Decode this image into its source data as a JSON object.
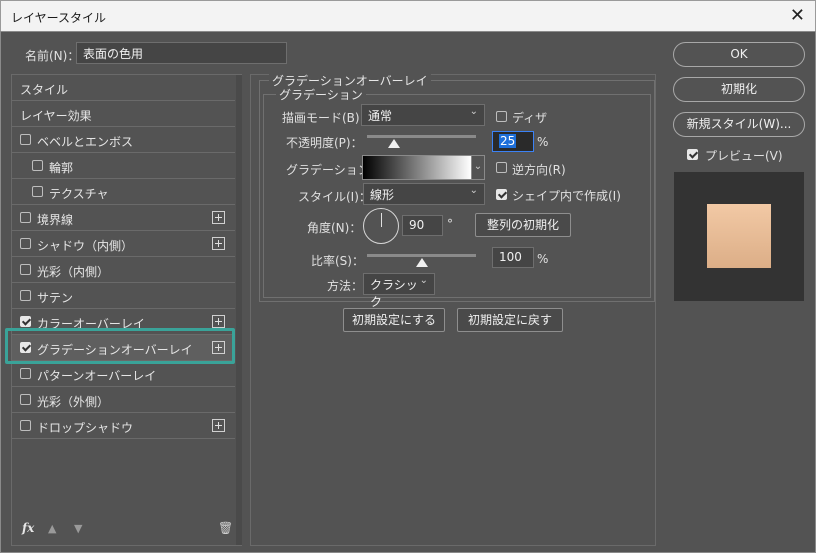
{
  "window": {
    "title": "レイヤースタイル"
  },
  "name": {
    "label": "名前(N)：",
    "value": "表面の色用"
  },
  "style_list": [
    {
      "label": "スタイル",
      "indent": 0,
      "checkbox": false,
      "checked": false,
      "plus": false,
      "selected": false
    },
    {
      "label": "レイヤー効果",
      "indent": 0,
      "checkbox": false,
      "checked": false,
      "plus": false,
      "selected": false
    },
    {
      "label": "ベベルとエンボス",
      "indent": 0,
      "checkbox": true,
      "checked": false,
      "plus": false,
      "selected": false
    },
    {
      "label": "輪郭",
      "indent": 1,
      "checkbox": true,
      "checked": false,
      "plus": false,
      "selected": false
    },
    {
      "label": "テクスチャ",
      "indent": 1,
      "checkbox": true,
      "checked": false,
      "plus": false,
      "selected": false
    },
    {
      "label": "境界線",
      "indent": 0,
      "checkbox": true,
      "checked": false,
      "plus": true,
      "selected": false
    },
    {
      "label": "シャドウ（内側）",
      "indent": 0,
      "checkbox": true,
      "checked": false,
      "plus": true,
      "selected": false
    },
    {
      "label": "光彩（内側）",
      "indent": 0,
      "checkbox": true,
      "checked": false,
      "plus": false,
      "selected": false
    },
    {
      "label": "サテン",
      "indent": 0,
      "checkbox": true,
      "checked": false,
      "plus": false,
      "selected": false
    },
    {
      "label": "カラーオーバーレイ",
      "indent": 0,
      "checkbox": true,
      "checked": true,
      "plus": true,
      "selected": false
    },
    {
      "label": "グラデーションオーバーレイ",
      "indent": 0,
      "checkbox": true,
      "checked": true,
      "plus": true,
      "selected": true
    },
    {
      "label": "パターンオーバーレイ",
      "indent": 0,
      "checkbox": true,
      "checked": false,
      "plus": false,
      "selected": false
    },
    {
      "label": "光彩（外側）",
      "indent": 0,
      "checkbox": true,
      "checked": false,
      "plus": false,
      "selected": false
    },
    {
      "label": "ドロップシャドウ",
      "indent": 0,
      "checkbox": true,
      "checked": false,
      "plus": true,
      "selected": false
    }
  ],
  "bottom_bar": {
    "fx": "fx",
    "up": "▲",
    "down": "▼",
    "trash": "🗑"
  },
  "gradient_overlay": {
    "section_title": "グラデーションオーバーレイ",
    "sub_title": "グラデーション",
    "blend_mode": {
      "label": "描画モード(B)：",
      "value": "通常"
    },
    "dither": {
      "label": "ディザ",
      "checked": false
    },
    "opacity": {
      "label": "不透明度(P)：",
      "value": "25",
      "unit": "%",
      "slider_level": 0.25
    },
    "gradient": {
      "label": "グラデーション："
    },
    "reverse": {
      "label": "逆方向(R)",
      "checked": false
    },
    "style": {
      "label": "スタイル(I)：",
      "value": "線形"
    },
    "align_with_shape": {
      "label": "シェイプ内で作成(I)",
      "checked": true
    },
    "angle": {
      "label": "角度(N)：",
      "value": "90",
      "unit": "°"
    },
    "reset_alignment": "整列の初期化",
    "scale": {
      "label": "比率(S)：",
      "value": "100",
      "unit": "%",
      "slider_level": 0.5
    },
    "method": {
      "label": "方法：",
      "value": "クラシック"
    },
    "make_default": "初期設定にする",
    "reset_to_default": "初期設定に戻す"
  },
  "buttons": {
    "ok": "OK",
    "reset": "初期化",
    "new_style": "新規スタイル(W)...",
    "preview": "プレビュー(V)",
    "preview_checked": true
  },
  "colors": {
    "dialog_bg": "#535353",
    "highlight": "#3aa399",
    "preview_swatch_top": "#f2c9a5",
    "preview_swatch_bottom": "#dcae87",
    "selection_blue": "#1e6fd9"
  }
}
